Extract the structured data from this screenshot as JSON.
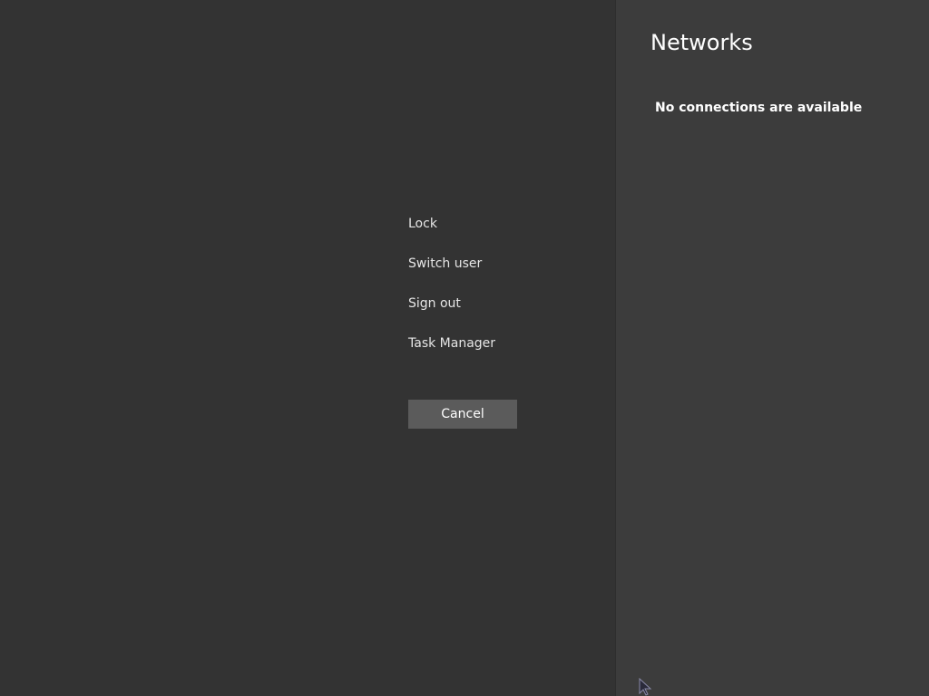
{
  "security_menu": {
    "items": [
      {
        "label": "Lock"
      },
      {
        "label": "Switch user"
      },
      {
        "label": "Sign out"
      },
      {
        "label": "Task Manager"
      }
    ],
    "cancel_label": "Cancel"
  },
  "networks": {
    "title": "Networks",
    "status": "No connections are available"
  },
  "cursor": {
    "icon": "mouse-pointer-icon"
  },
  "colors": {
    "background": "#333333",
    "panel": "#3c3c3c",
    "button": "#5b5b5b"
  }
}
